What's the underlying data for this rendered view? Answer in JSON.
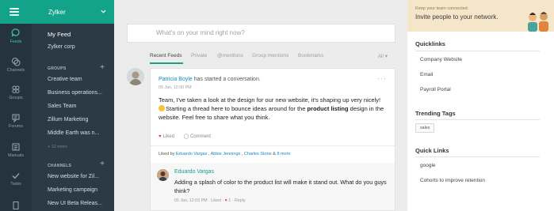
{
  "org": {
    "name": "Zylker"
  },
  "leftnav": [
    {
      "label": "Feeds",
      "icon": "feeds-icon"
    },
    {
      "label": "Channels",
      "icon": "channels-icon"
    },
    {
      "label": "Groups",
      "icon": "groups-icon"
    },
    {
      "label": "Forums",
      "icon": "forums-icon"
    },
    {
      "label": "Manuals",
      "icon": "manuals-icon"
    },
    {
      "label": "Tasks",
      "icon": "tasks-icon"
    }
  ],
  "panel": {
    "my_feed": "My Feed",
    "org_feed": "Zylker corp",
    "groups_header": "GROUPS",
    "groups": [
      "Creative team",
      "Business operations...",
      "Sales Team",
      "Zillum Marketing",
      "Middle Earth was n..."
    ],
    "groups_more": "+ 12 more",
    "channels_header": "CHANNELS",
    "channels": [
      "New website for Zil...",
      "Marketing campaign",
      "New UI Beta Releas..."
    ]
  },
  "compose": {
    "placeholder": "What's on your mind right now?"
  },
  "tabs": [
    {
      "label": "Recent Feeds"
    },
    {
      "label": "Private"
    },
    {
      "label": "@mentions"
    },
    {
      "label": "Group mentions"
    },
    {
      "label": "Bookmarks"
    }
  ],
  "tab_filter": "All ▾",
  "post": {
    "author": "Patricia Boyle",
    "action": " has started a conversation.",
    "date": "05 Jan, 12:00 PM",
    "more": "···",
    "body_line1": "Team, I've taken a look at the design for our new website, it's shaping up very nicely!",
    "body_line2_pre": "Starting a thread here to bounce ideas around for the ",
    "body_bold": "product listing",
    "body_line2_post": " design in the website. Feel free to share what you think.",
    "liked_label": "Liked",
    "comment_label": "Comment",
    "liked_by_prefix": "Liked by ",
    "liked_by": [
      "Eduardo Vargas",
      "Abbie Jennings",
      "Charles Stone"
    ],
    "liked_by_more": "8 more",
    "reply": {
      "author": "Eduardo Vargas",
      "text": "Adding a splash of color to the product list will make it stand out. What do you guys think?",
      "date": "05 Jan, 12:03 PM",
      "liked": "Liked",
      "like_count": "1",
      "reply": "Reply"
    }
  },
  "sidebar": {
    "banner_small": "Keep your team connected.",
    "banner_big": "Invite people to your network.",
    "quicklinks_title": "Quicklinks",
    "quicklinks": [
      "Company Website",
      "Email",
      "Payroll Portal"
    ],
    "trending_title": "Trending Tags",
    "trending_tags": [
      "sales"
    ],
    "quick_links_title": "Quick Links",
    "quick_links": [
      "google",
      "Cohorts to improve retention"
    ]
  },
  "colors": {
    "accent": "#13a28a",
    "nav_bg": "#25333e",
    "panel_bg": "#2c3a46",
    "link": "#1687c2",
    "heart": "#e03b4a"
  }
}
